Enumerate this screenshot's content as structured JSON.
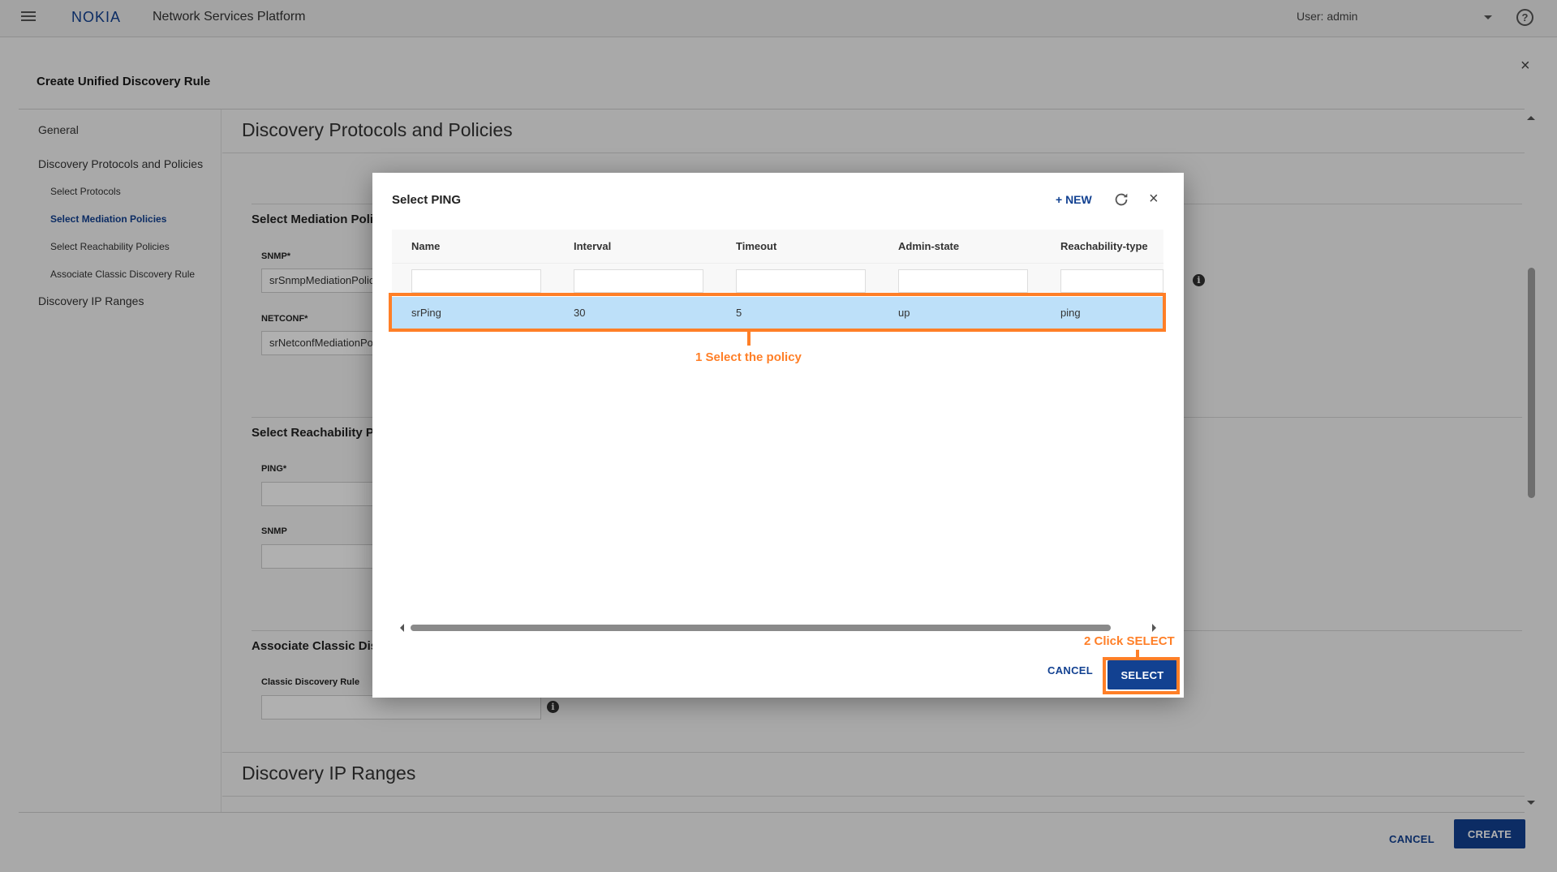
{
  "topbar": {
    "brand": "NOKIA",
    "app_title": "Network Services Platform",
    "user_label": "User: admin",
    "help_glyph": "?"
  },
  "page": {
    "title": "Create Unified Discovery Rule",
    "close_glyph": "×"
  },
  "left_nav": {
    "items": [
      {
        "label": "General",
        "level": 1,
        "active": false
      },
      {
        "label": "Discovery Protocols and Policies",
        "level": 1,
        "active": false
      },
      {
        "label": "Select Protocols",
        "level": 2,
        "active": false
      },
      {
        "label": "Select Mediation Policies",
        "level": 2,
        "active": true
      },
      {
        "label": "Select Reachability Policies",
        "level": 2,
        "active": false
      },
      {
        "label": "Associate Classic Discovery Rule",
        "level": 2,
        "active": false
      },
      {
        "label": "Discovery IP Ranges",
        "level": 1,
        "active": false
      }
    ]
  },
  "form": {
    "section_protocols": "Discovery Protocols and Policies",
    "mediation": {
      "title": "Select Mediation Policies",
      "snmp_label": "SNMP*",
      "snmp_value": "srSnmpMediationPolicy",
      "netconf_label": "NETCONF*",
      "netconf_value": "srNetconfMediationPolicy"
    },
    "reachability": {
      "title": "Select Reachability Policies",
      "ping_label": "PING*",
      "ping_value": "",
      "snmp_label": "SNMP",
      "snmp_value": ""
    },
    "classic": {
      "title": "Associate Classic Discovery Rule",
      "rule_label": "Classic Discovery Rule",
      "rule_value": ""
    },
    "section_ip_ranges": "Discovery IP Ranges",
    "info_glyph": "i"
  },
  "footer": {
    "cancel_label": "CANCEL",
    "create_label": "CREATE"
  },
  "dialog": {
    "title": "Select PING",
    "new_label": "+ NEW",
    "close_glyph": "×",
    "columns": [
      "Name",
      "Interval",
      "Timeout",
      "Admin-state",
      "Reachability-type"
    ],
    "filters": [
      "",
      "",
      "",
      "",
      ""
    ],
    "rows": [
      {
        "name": "srPing",
        "interval": "30",
        "timeout": "5",
        "admin_state": "up",
        "reachability_type": "ping",
        "selected": true
      }
    ],
    "cancel_label": "CANCEL",
    "select_label": "SELECT"
  },
  "annotations": {
    "step1": "1  Select the policy",
    "step2": "2  Click SELECT",
    "color": "#ff7f27"
  },
  "colors": {
    "brand_blue": "#124191",
    "selected_row": "#bde0f9"
  }
}
